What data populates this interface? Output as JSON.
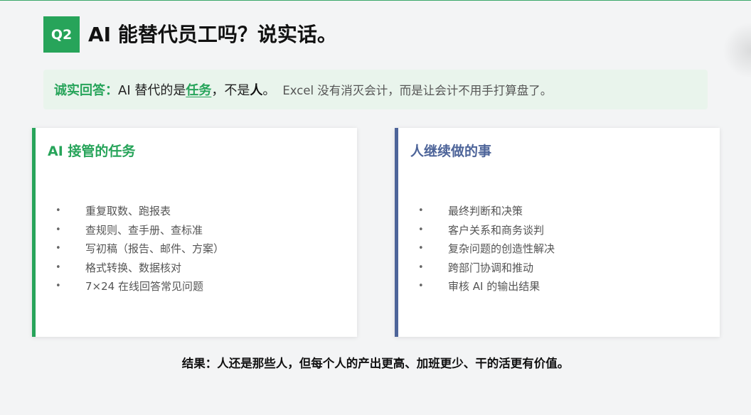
{
  "header": {
    "badge": "Q2",
    "title": "AI 能替代员工吗？说实话。"
  },
  "answer": {
    "label": "诚实回答：",
    "part1": "AI 替代的是",
    "highlight": "任务",
    "part2": "，不是",
    "strong": "人",
    "part3": "。",
    "note": "Excel 没有消灭会计，而是让会计不用手打算盘了。"
  },
  "left_card": {
    "title": "AI 接管的任务",
    "items": [
      "重复取数、跑报表",
      "查规则、查手册、查标准",
      "写初稿（报告、邮件、方案）",
      "格式转换、数据核对",
      "7×24 在线回答常见问题"
    ]
  },
  "right_card": {
    "title": "人继续做的事",
    "items": [
      "最终判断和决策",
      "客户关系和商务谈判",
      "复杂问题的创造性解决",
      "跨部门协调和推动",
      "审核 AI 的输出结果"
    ]
  },
  "conclusion": "结果：人还是那些人，但每个人的产出更高、加班更少、干的活更有价值。",
  "colors": {
    "green": "#27a45a",
    "blue": "#4d6499",
    "answer_bg": "#e9f4ec"
  },
  "bullet_glyph": "•"
}
